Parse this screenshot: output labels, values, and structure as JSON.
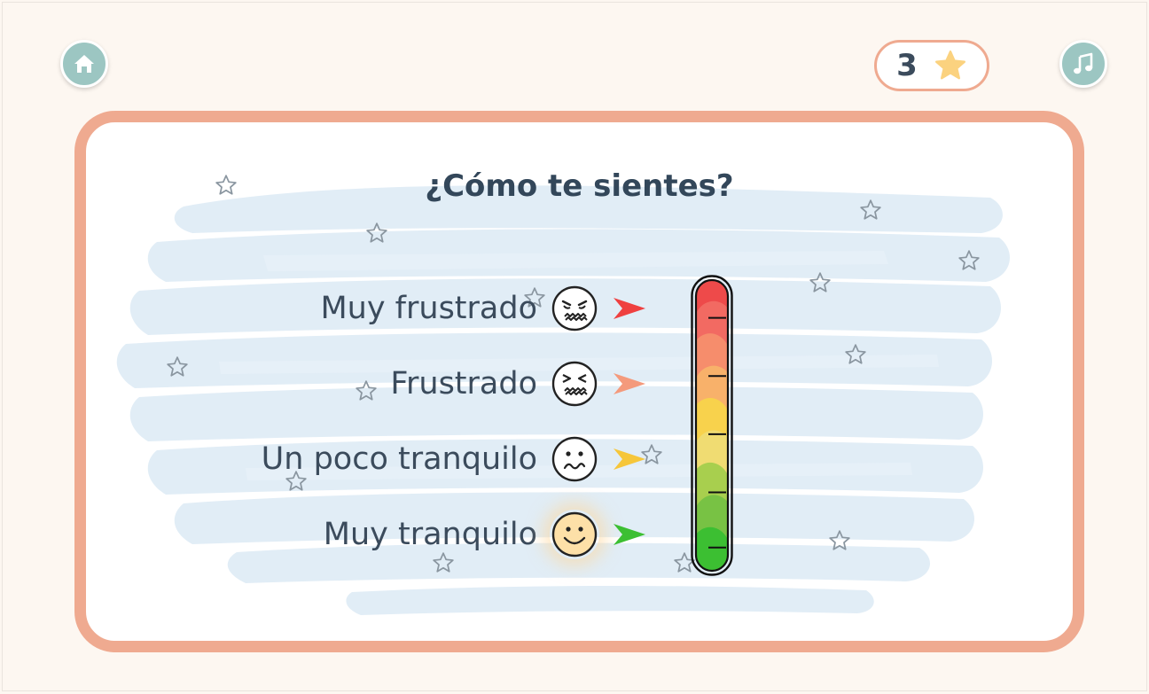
{
  "header": {
    "home_icon": "home-icon",
    "music_icon": "music-note-icon",
    "score": {
      "value": "3",
      "icon": "star-icon"
    }
  },
  "card": {
    "title": "¿Cómo te sientes?",
    "options": [
      {
        "label": "Muy frustrado",
        "face": "very-frustrated-face-icon",
        "arrow_color": "#ef4040",
        "selected": false
      },
      {
        "label": "Frustrado",
        "face": "frustrated-face-icon",
        "arrow_color": "#f49a7c",
        "selected": false
      },
      {
        "label": "Un poco tranquilo",
        "face": "slightly-calm-face-icon",
        "arrow_color": "#f6c63a",
        "selected": false
      },
      {
        "label": "Muy tranquilo",
        "face": "very-calm-face-icon",
        "arrow_color": "#3cbf32",
        "selected": true
      }
    ]
  },
  "meter": {
    "type": "emotion-thermometer",
    "colors": [
      "#ee4a4a",
      "#f26a62",
      "#f68d6c",
      "#f8b16a",
      "#f8d24c",
      "#f0dc72",
      "#a8cf4e",
      "#78c244",
      "#3cbf32"
    ]
  },
  "colors": {
    "background": "#fdf7f1",
    "card_border": "#efaa90",
    "button_teal": "#9cc6c2",
    "text": "#3b4b5c",
    "star_gold": "#fbd27f"
  }
}
